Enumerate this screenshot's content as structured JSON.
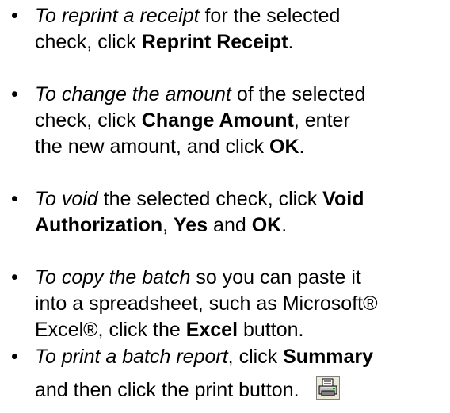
{
  "instructions": [
    {
      "lines": [
        [
          {
            "t": "To reprint a receipt",
            "s": "i"
          },
          {
            "t": " for the selected",
            "s": ""
          }
        ],
        [
          {
            "t": "check, click ",
            "s": ""
          },
          {
            "t": "Reprint Receipt",
            "s": "b"
          },
          {
            "t": ".",
            "s": ""
          }
        ]
      ]
    },
    {
      "lines": [
        [
          {
            "t": "To change the amount",
            "s": "i"
          },
          {
            "t": " of the selected",
            "s": ""
          }
        ],
        [
          {
            "t": "check, click ",
            "s": ""
          },
          {
            "t": "Change Amount",
            "s": "b"
          },
          {
            "t": ", enter",
            "s": ""
          }
        ],
        [
          {
            "t": "the new amount, and click ",
            "s": ""
          },
          {
            "t": "OK",
            "s": "b"
          },
          {
            "t": ".",
            "s": ""
          }
        ]
      ]
    },
    {
      "lines": [
        [
          {
            "t": "To void",
            "s": "i"
          },
          {
            "t": " the selected check, click ",
            "s": ""
          },
          {
            "t": "Void",
            "s": "b"
          }
        ],
        [
          {
            "t": "Authorization",
            "s": "b"
          },
          {
            "t": ", ",
            "s": ""
          },
          {
            "t": "Yes",
            "s": "b"
          },
          {
            "t": " and ",
            "s": ""
          },
          {
            "t": "OK",
            "s": "b"
          },
          {
            "t": ".",
            "s": ""
          }
        ]
      ]
    },
    {
      "lines": [
        [
          {
            "t": "To copy the batch",
            "s": "i"
          },
          {
            "t": " so you can paste it",
            "s": ""
          }
        ],
        [
          {
            "t": "into a spreadsheet, such as Microsoft®",
            "s": ""
          }
        ],
        [
          {
            "t": "Excel®, click the ",
            "s": ""
          },
          {
            "t": "Excel",
            "s": "b"
          },
          {
            "t": " button.",
            "s": ""
          }
        ]
      ]
    },
    {
      "lines": [
        [
          {
            "t": "To print a batch report",
            "s": "i"
          },
          {
            "t": ", click ",
            "s": ""
          },
          {
            "t": "Summary",
            "s": "b"
          }
        ],
        [
          {
            "t": "and then click the print button.",
            "s": ""
          }
        ]
      ],
      "trailing_icon": "printer-icon"
    }
  ]
}
